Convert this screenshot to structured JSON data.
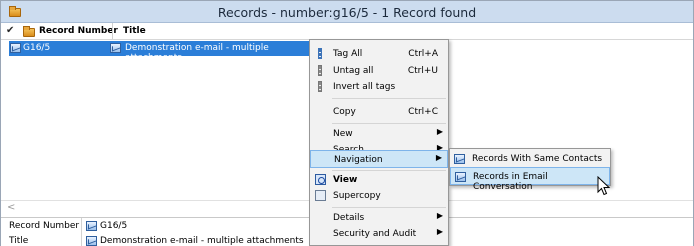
{
  "window": {
    "title": "Records - number:g16/5 - 1 Record found",
    "icon": "folder-icon"
  },
  "columns": {
    "record_number": "Record Number",
    "title": "Title"
  },
  "rows": [
    {
      "record_number": "G16/5",
      "title": "Demonstration e-mail - multiple attachments"
    }
  ],
  "scroll": {
    "left_arrow": "<"
  },
  "details": {
    "record_number_label": "Record Number",
    "record_number_value": "G16/5",
    "title_label": "Title",
    "title_value": "Demonstration e-mail - multiple attachments"
  },
  "context_menu": {
    "tag_all": {
      "label": "Tag All",
      "shortcut": "Ctrl+A"
    },
    "untag_all": {
      "label": "Untag all",
      "shortcut": "Ctrl+U"
    },
    "invert_all_tags": {
      "label": "Invert all tags"
    },
    "copy": {
      "label": "Copy",
      "shortcut": "Ctrl+C"
    },
    "new": {
      "label": "New"
    },
    "search": {
      "label": "Search"
    },
    "navigation": {
      "label": "Navigation"
    },
    "view": {
      "label": "View"
    },
    "supercopy": {
      "label": "Supercopy"
    },
    "details": {
      "label": "Details"
    },
    "security_and_audit": {
      "label": "Security and Audit"
    },
    "submenu_arrow": "▶"
  },
  "navigation_submenu": {
    "items": [
      {
        "label": "Records With Same Contacts"
      },
      {
        "label": "Records in Email Conversation"
      }
    ]
  },
  "colors": {
    "selection": "#2b7ed8",
    "menu_highlight": "#cde6f7",
    "titlebar": "#ccdcef"
  }
}
